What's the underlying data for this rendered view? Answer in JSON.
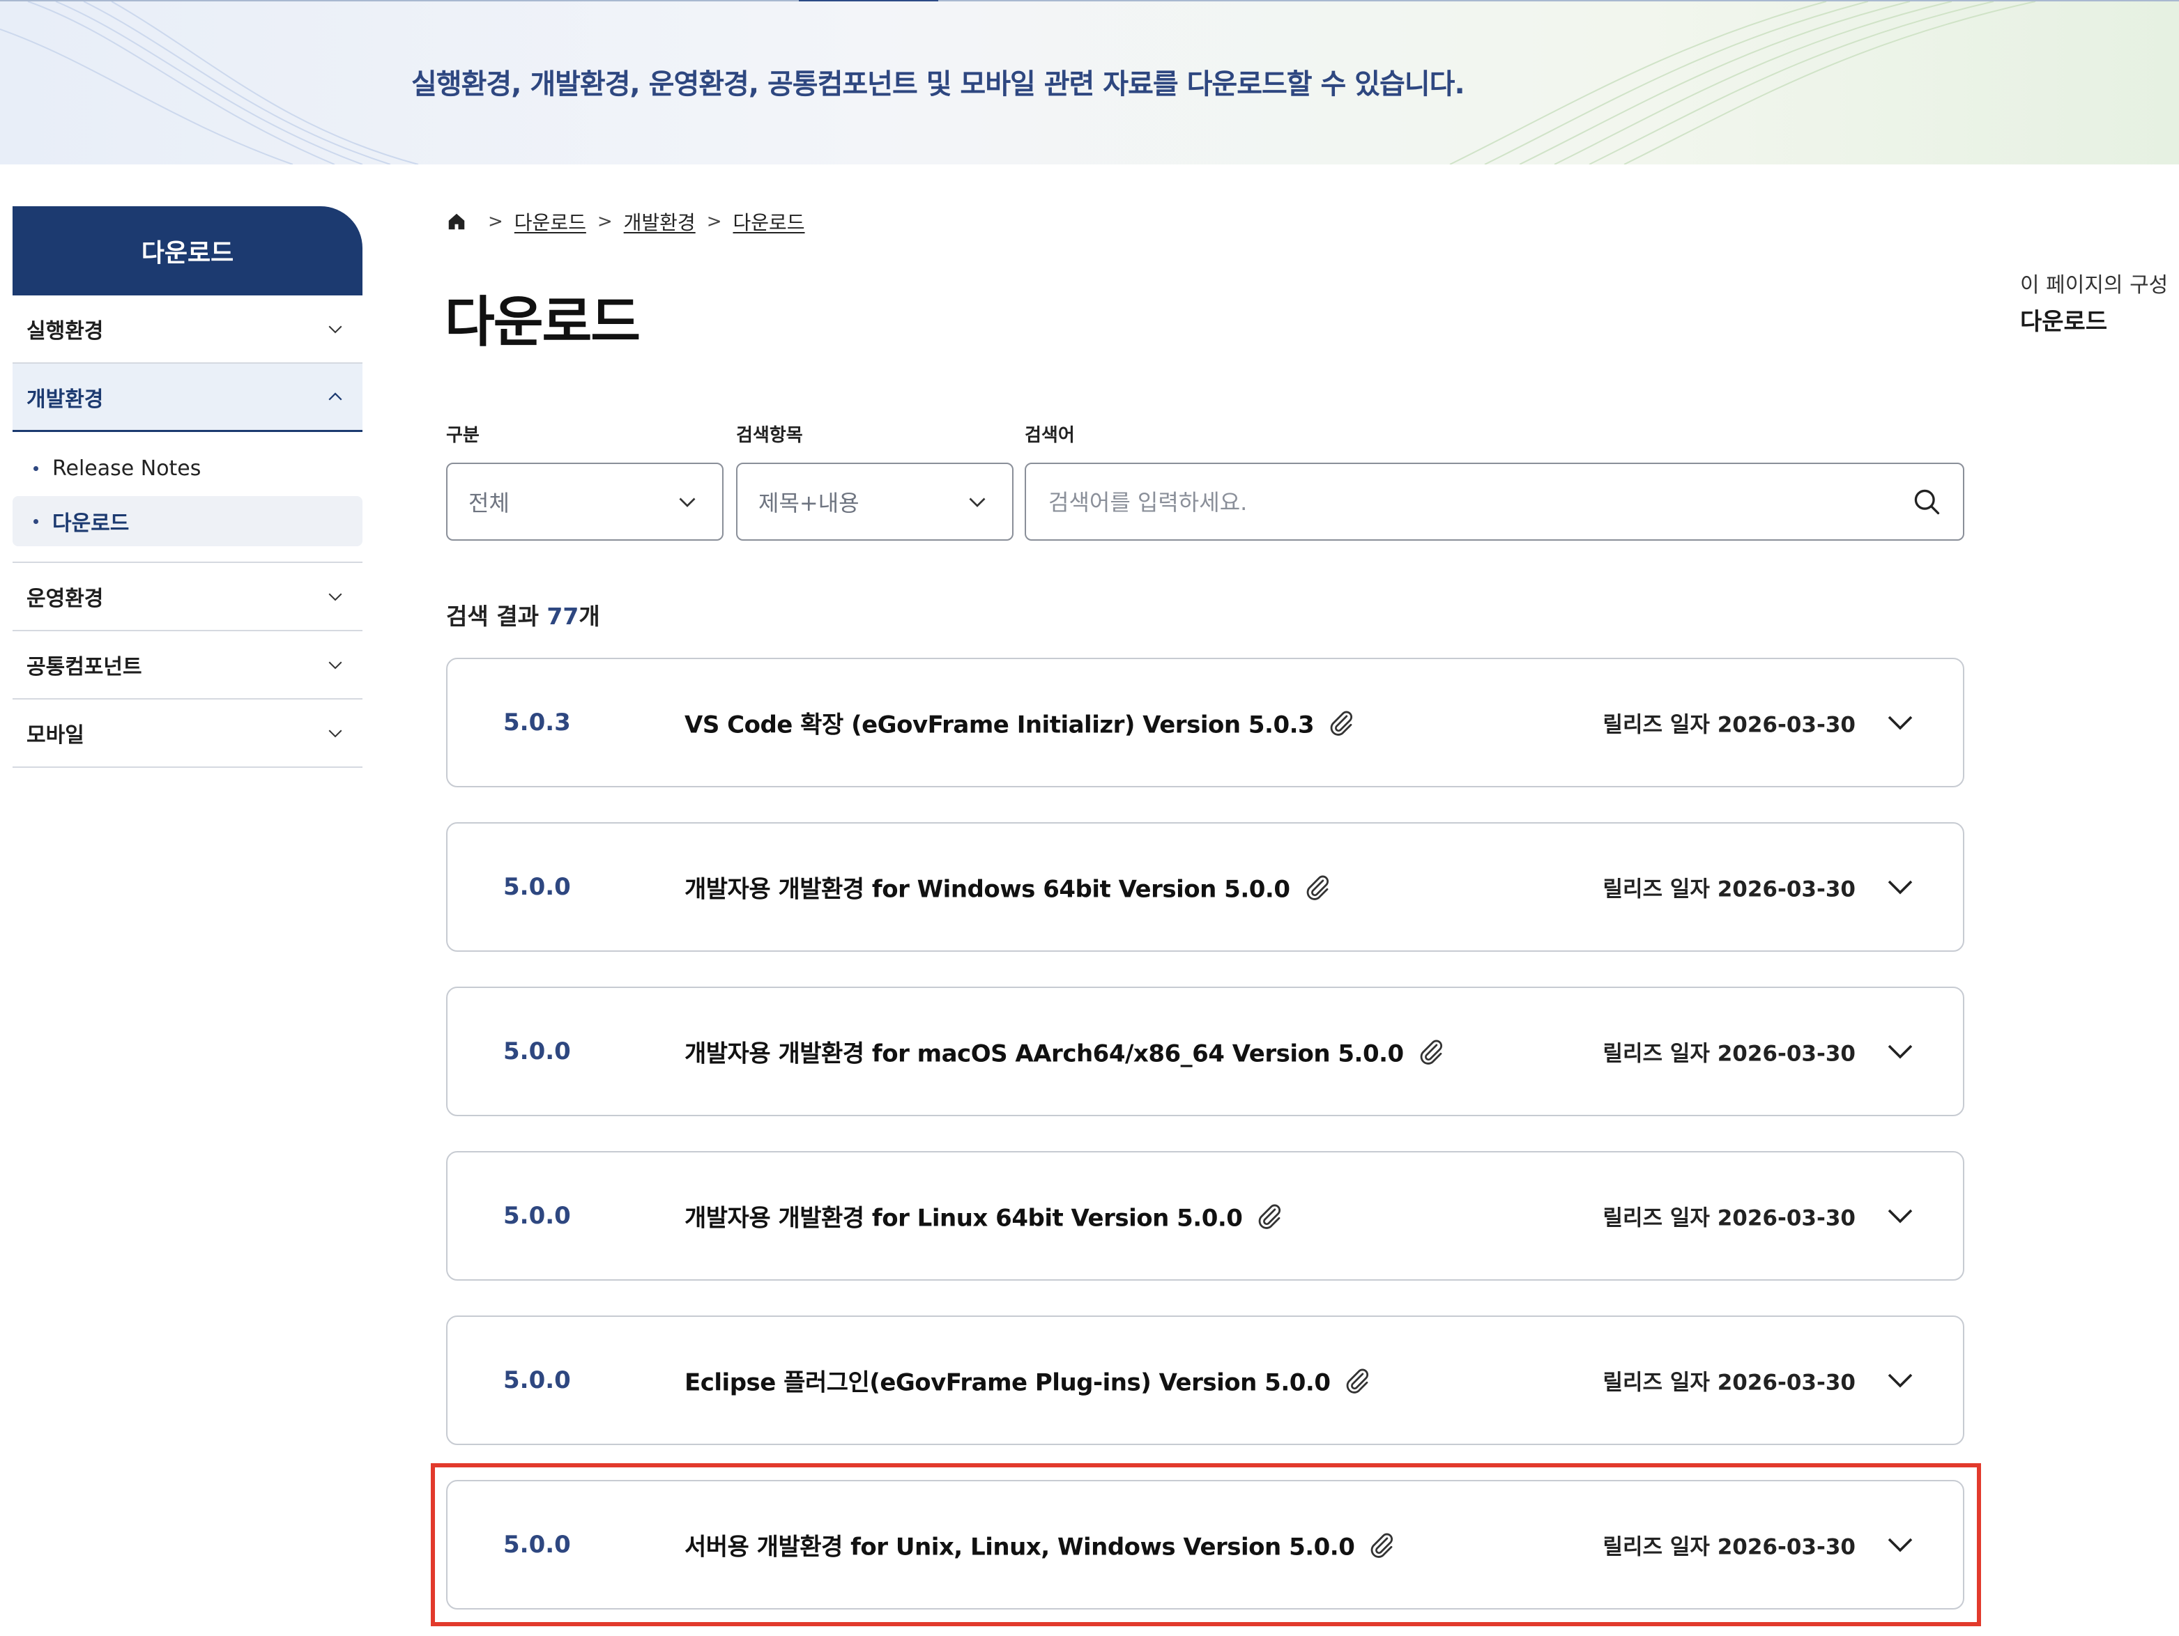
{
  "banner": {
    "text": "실행환경, 개발환경, 운영환경, 공통컴포넌트 및 모바일 관련 자료를 다운로드할 수 있습니다."
  },
  "sidebar": {
    "title": "다운로드",
    "items": [
      {
        "label": "실행환경",
        "expanded": false
      },
      {
        "label": "개발환경",
        "expanded": true
      },
      {
        "label": "운영환경",
        "expanded": false
      },
      {
        "label": "공통컴포넌트",
        "expanded": false
      },
      {
        "label": "모바일",
        "expanded": false
      }
    ],
    "sub_items": [
      {
        "label": "Release Notes",
        "current": false
      },
      {
        "label": "다운로드",
        "current": true
      }
    ]
  },
  "breadcrumb": [
    "다운로드",
    "개발환경",
    "다운로드"
  ],
  "page_title": "다운로드",
  "filters": {
    "category_label": "구분",
    "category_value": "전체",
    "field_label": "검색항목",
    "field_value": "제목+내용",
    "keyword_label": "검색어",
    "keyword_placeholder": "검색어를 입력하세요."
  },
  "results": {
    "prefix": "검색 결과 ",
    "count": "77",
    "suffix": "개",
    "date_label": "릴리즈 일자",
    "items": [
      {
        "version": "5.0.3",
        "title": "VS Code 확장 (eGovFrame Initializr) Version 5.0.3",
        "date": "2026-03-30"
      },
      {
        "version": "5.0.0",
        "title": "개발자용 개발환경 for Windows 64bit Version 5.0.0",
        "date": "2026-03-30"
      },
      {
        "version": "5.0.0",
        "title": "개발자용 개발환경 for macOS AArch64/x86_64 Version 5.0.0",
        "date": "2026-03-30"
      },
      {
        "version": "5.0.0",
        "title": "개발자용 개발환경 for Linux 64bit Version 5.0.0",
        "date": "2026-03-30"
      },
      {
        "version": "5.0.0",
        "title": "Eclipse 플러그인(eGovFrame Plug-ins) Version 5.0.0",
        "date": "2026-03-30"
      },
      {
        "version": "5.0.0",
        "title": "서버용 개발환경 for Unix, Linux, Windows Version 5.0.0",
        "date": "2026-03-30"
      }
    ]
  },
  "toc": {
    "title": "이 페이지의 구성",
    "links": [
      "다운로드"
    ]
  },
  "colors": {
    "primary": "#1c3a70",
    "accent_text": "#2e4780",
    "highlight": "#e23a2c"
  },
  "icons": {
    "home": "home-icon",
    "chevron": "chevron-down-icon",
    "search": "search-icon",
    "attachment": "paperclip-icon"
  }
}
